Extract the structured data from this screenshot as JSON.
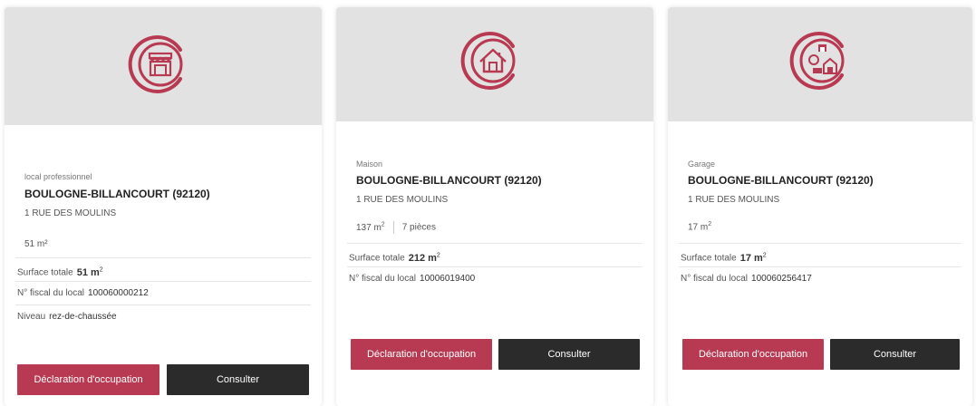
{
  "accent_color": "#b83a52",
  "cards": [
    {
      "icon": "shop-icon",
      "type": "local professionnel",
      "city": "BOULOGNE-BILLANCOURT (92120)",
      "street": "1 RUE DES MOULINS",
      "area": "51 m²",
      "surface_label": "Surface totale",
      "surface_value": "51 m",
      "surface_sup": "2",
      "fiscal_label": "N° fiscal du local",
      "fiscal_value": "100060000212",
      "level_label": "Niveau",
      "level_value": "rez-de-chaussée",
      "declaration_label": "Déclaration d'occupation",
      "consult_label": "Consulter"
    },
    {
      "icon": "house-icon",
      "type": "Maison",
      "city": "BOULOGNE-BILLANCOURT (92120)",
      "street": "1 RUE DES MOULINS",
      "area": "137 m",
      "area_sup": "2",
      "rooms": "7 pièces",
      "surface_label": "Surface totale",
      "surface_value": "212 m",
      "surface_sup": "2",
      "fiscal_label": "N° fiscal du local",
      "fiscal_value": "10006019400",
      "declaration_label": "Déclaration d'occupation",
      "consult_label": "Consulter"
    },
    {
      "icon": "garage-icon",
      "type": "Garage",
      "city": "BOULOGNE-BILLANCOURT (92120)",
      "street": "1 RUE DES MOULINS",
      "area": "17 m",
      "area_sup": "2",
      "surface_label": "Surface totale",
      "surface_value": "17 m",
      "surface_sup": "2",
      "fiscal_label": "N° fiscal du local",
      "fiscal_value": "100060256417",
      "declaration_label": "Déclaration d'occupation",
      "consult_label": "Consulter"
    }
  ]
}
